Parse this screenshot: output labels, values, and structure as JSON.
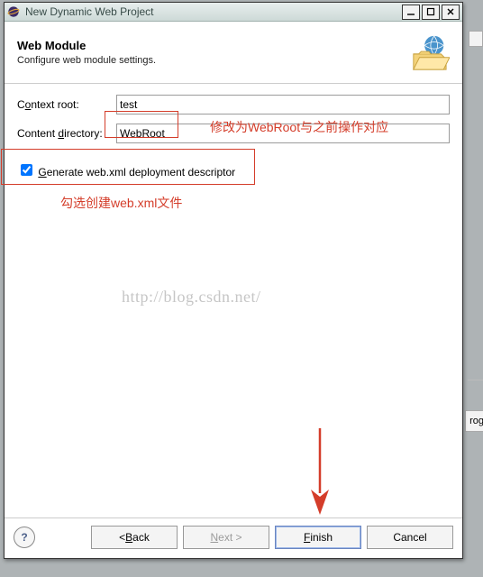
{
  "titlebar": {
    "title": "New Dynamic Web Project"
  },
  "banner": {
    "heading": "Web Module",
    "subtitle": "Configure web module settings."
  },
  "form": {
    "context_root_label_pre": "C",
    "context_root_label_u": "o",
    "context_root_label_post": "ntext root:",
    "context_root_value": "test",
    "content_dir_label_pre": "Content ",
    "content_dir_label_u": "d",
    "content_dir_label_post": "irectory:",
    "content_dir_value": "WebRoot"
  },
  "checkbox": {
    "label_pre": "",
    "label_u": "G",
    "label_post": "enerate web.xml deployment descriptor",
    "checked": true
  },
  "annotations": {
    "a1": "修改为WebRoot与之前操作对应",
    "a2": "勾选创建web.xml文件"
  },
  "watermark": "http://blog.csdn.net/",
  "buttons": {
    "back_pre": "< ",
    "back_u": "B",
    "back_post": "ack",
    "next_pre": "",
    "next_u": "N",
    "next_post": "ext >",
    "finish_pre": "",
    "finish_u": "F",
    "finish_post": "inish",
    "cancel": "Cancel",
    "help": "?"
  },
  "side": {
    "frag": "rog"
  }
}
